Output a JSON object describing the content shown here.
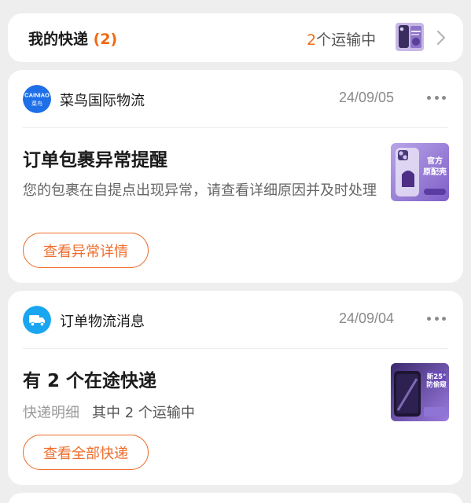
{
  "summary": {
    "title": "我的快递",
    "count": "(2)",
    "status_num": "2",
    "status_text": "个运输中",
    "thumb_icon": "phone-case-product-thumbnail",
    "chevron_icon": "chevron-right-icon"
  },
  "messages": [
    {
      "source": "菜鸟国际物流",
      "logo_icon": "cainiao-logo",
      "logo_text": "CAINIAO",
      "logo_cn": "菜鸟",
      "date": "24/09/05",
      "title": "订单包裹异常提醒",
      "body": "您的包裹在自提点出现异常，请查看详细原因并及时处理",
      "action": "查看异常详情",
      "thumb_icon": "phone-case-product-thumbnail",
      "thumb_tag_1": "官方",
      "thumb_tag_2": "原配壳"
    },
    {
      "source": "订单物流消息",
      "logo_icon": "truck-icon",
      "date": "24/09/04",
      "title": "有 2 个在途快递",
      "detail_label": "快递明细",
      "detail_value": "其中 2 个运输中",
      "action": "查看全部快递",
      "thumb_icon": "screen-protector-product-thumbnail",
      "thumb_tag_1": "新25°",
      "thumb_tag_2": "防偷窥"
    }
  ],
  "colors": {
    "accent": "#f06a12",
    "cainiao_blue": "#1e6fe8",
    "truck_blue": "#1aa5f0",
    "background": "#eeeeef"
  }
}
